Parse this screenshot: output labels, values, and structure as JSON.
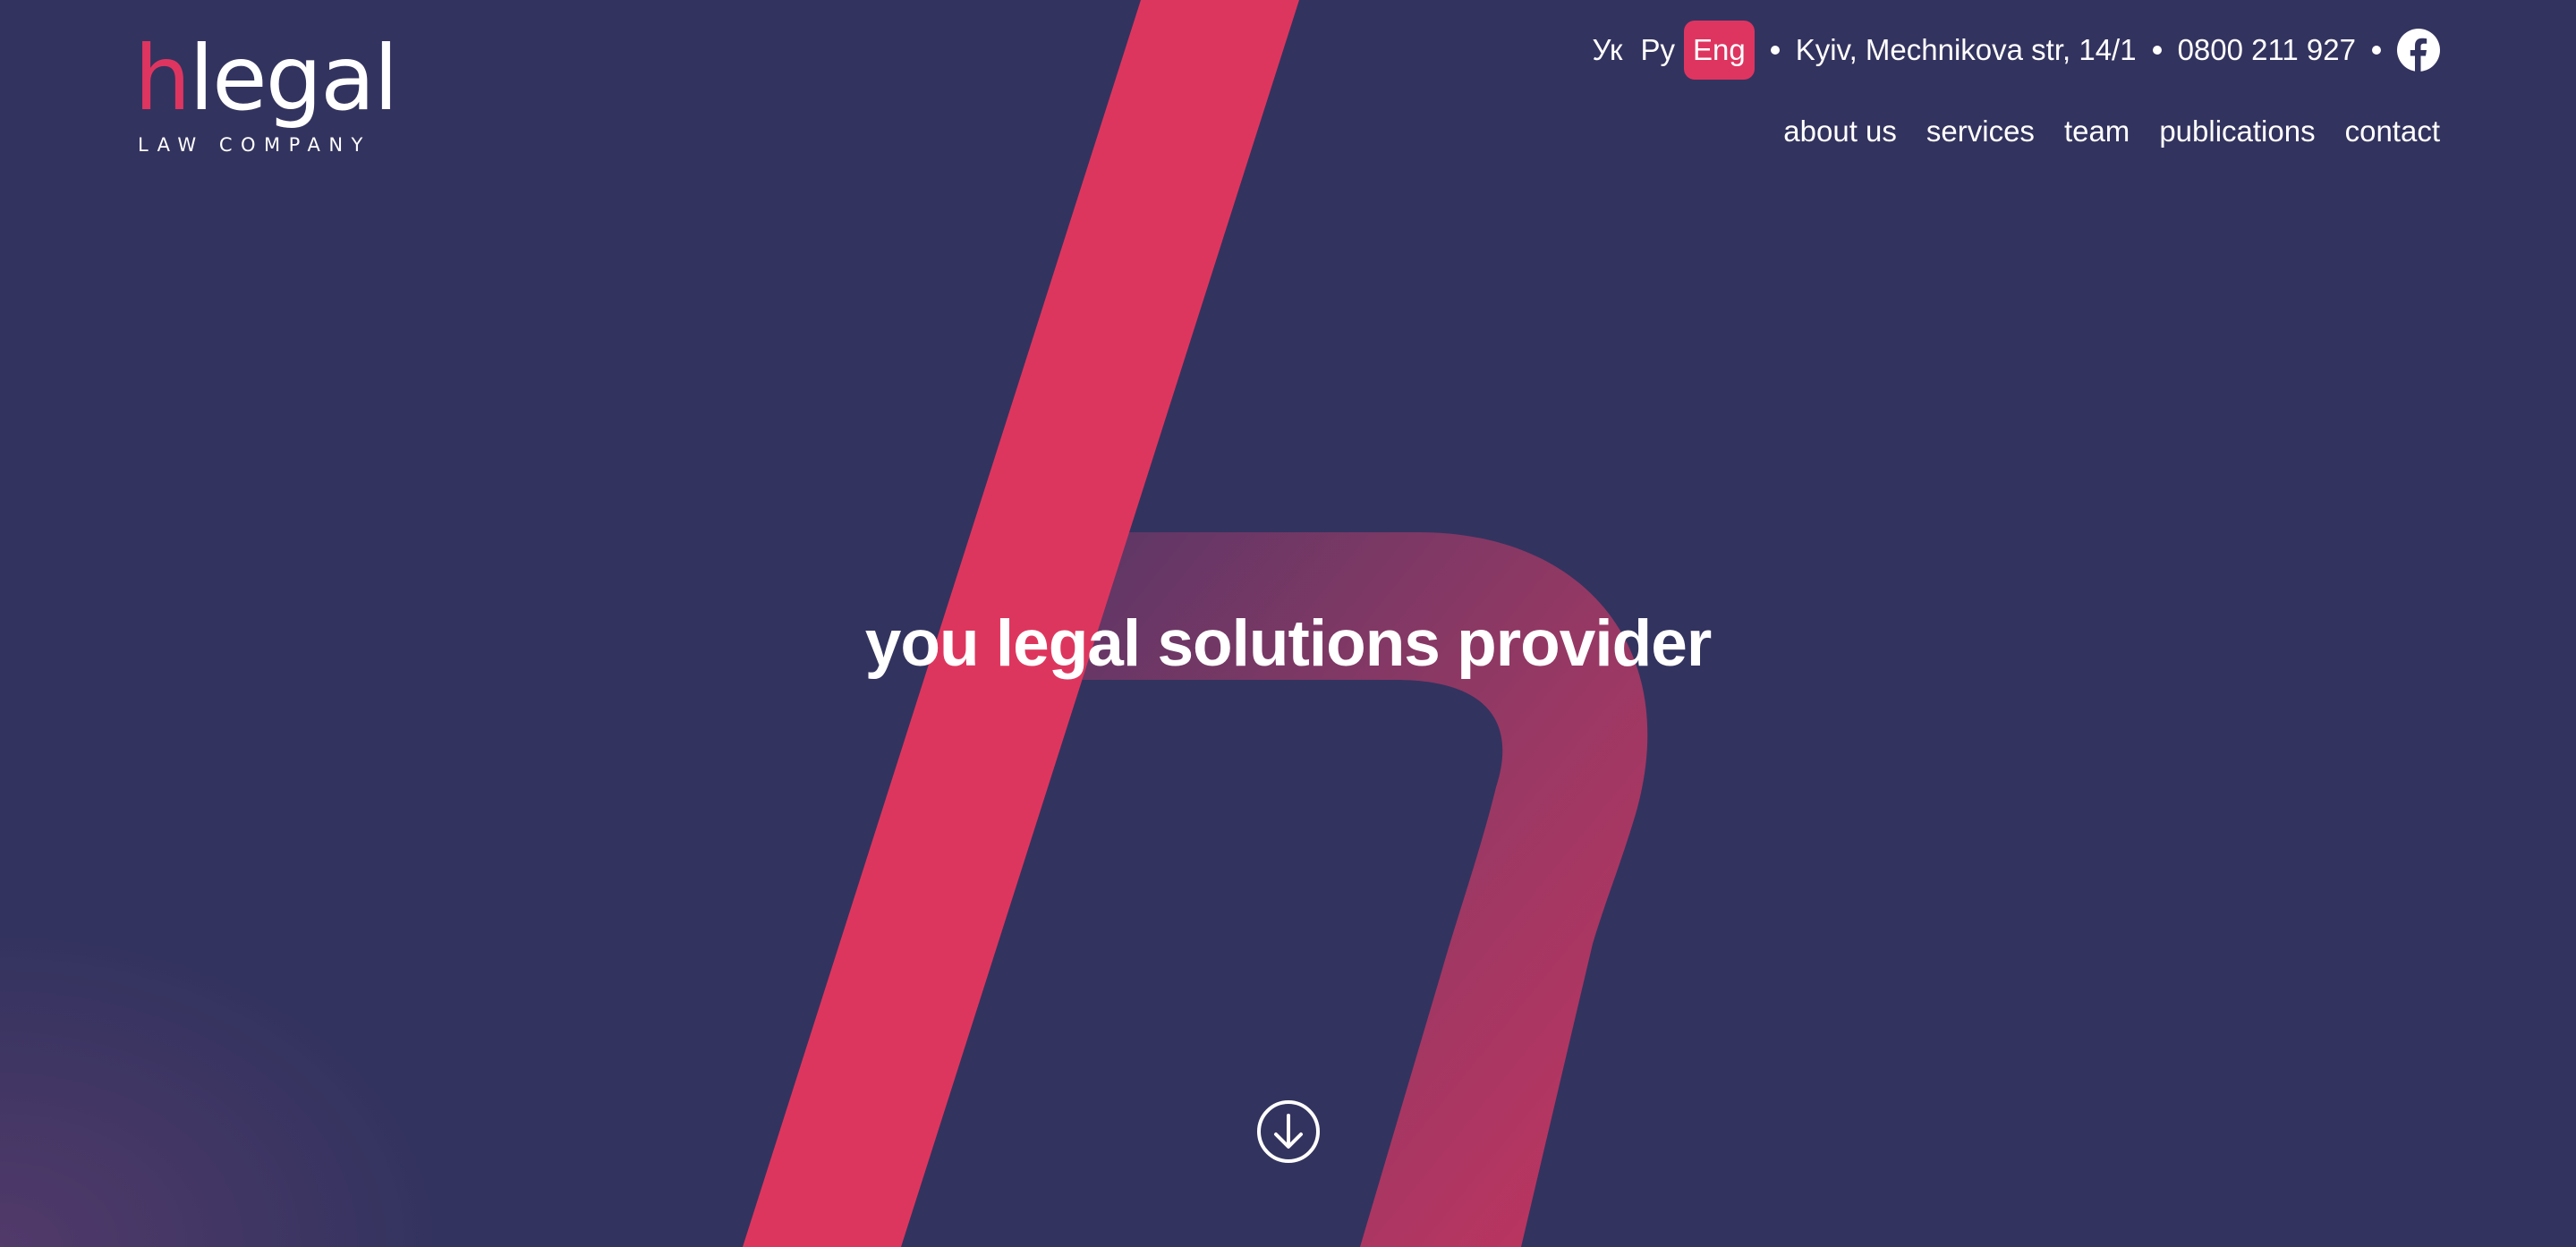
{
  "brand": {
    "logo_h": "h",
    "logo_rest": "legal",
    "logo_subtitle": "LAW COMPANY",
    "accent_color": "#de3560",
    "background_color": "#33335f"
  },
  "topbar": {
    "languages": [
      "Ук",
      "Ру",
      "Eng"
    ],
    "active_language": "Eng",
    "address": "Kyiv, Mechnikova str, 14/1",
    "phone": "0800 211 927",
    "social_icon": "facebook-icon"
  },
  "nav": {
    "items": [
      "about us",
      "services",
      "team",
      "publications",
      "contact"
    ]
  },
  "hero": {
    "tagline": "you legal solutions provider",
    "scroll_icon": "arrow-down-circle-icon"
  }
}
